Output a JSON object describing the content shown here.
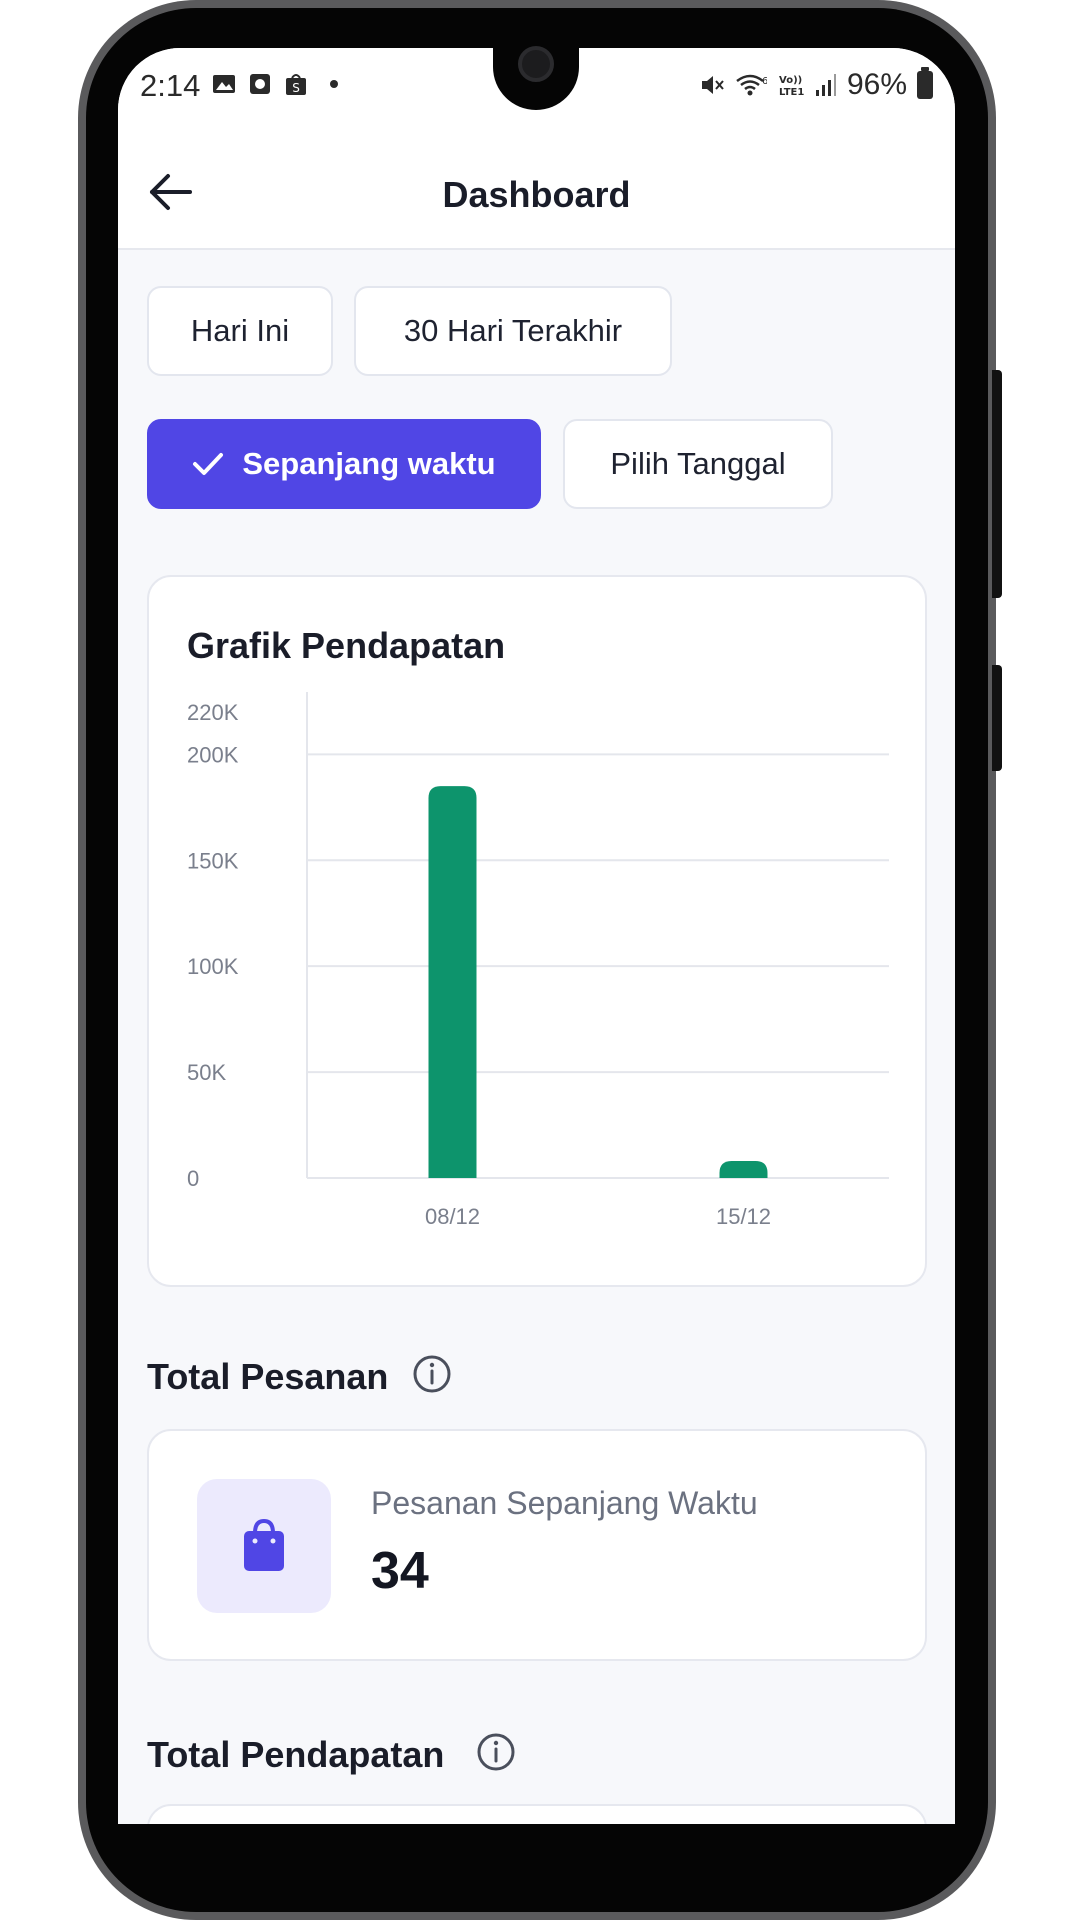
{
  "status_bar": {
    "time": "2:14",
    "battery": "96%",
    "left_icons": [
      "gallery-icon",
      "clock-app-icon",
      "shop-icon"
    ],
    "right_icons": [
      "mute-icon",
      "wifi-icon",
      "volte-icon",
      "signal-icon",
      "battery-icon"
    ],
    "volte_text": "Vo))\nLTE1"
  },
  "header": {
    "title": "Dashboard",
    "back_icon": "arrow-left-icon"
  },
  "filters": {
    "today": "Hari Ini",
    "last30": "30 Hari Terakhir",
    "all_time": "Sepanjang waktu",
    "pick_date": "Pilih Tanggal",
    "selected": "all_time"
  },
  "chart_card": {
    "title": "Grafik Pendapatan"
  },
  "chart_data": {
    "type": "bar",
    "title": "Grafik Pendapatan",
    "categories": [
      "08/12",
      "15/12"
    ],
    "values": [
      185000,
      8000
    ],
    "y_ticks": [
      0,
      50000,
      100000,
      150000,
      200000,
      220000
    ],
    "y_tick_labels": [
      "0",
      "50K",
      "100K",
      "150K",
      "200K",
      "220K"
    ],
    "ylim": [
      0,
      220000
    ],
    "grid": true,
    "bar_color": "#0d946c",
    "xlabel": "",
    "ylabel": ""
  },
  "orders": {
    "section_title": "Total Pesanan",
    "label": "Pesanan Sepanjang Waktu",
    "value": "34",
    "icon": "shopping-bag-icon"
  },
  "revenue": {
    "section_title": "Total Pendapatan"
  },
  "colors": {
    "accent": "#5046e5",
    "bar": "#0d946c",
    "icon_bg": "#eceafd"
  }
}
